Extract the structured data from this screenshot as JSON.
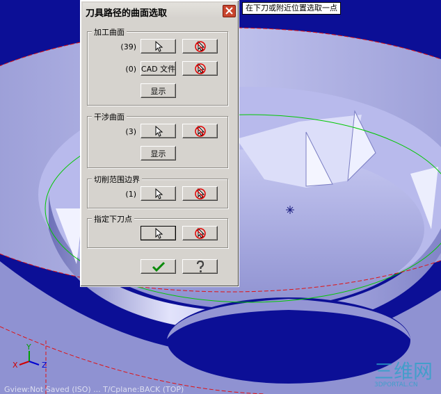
{
  "viewport": {
    "prompt": "在下刀或附近位置选取一点",
    "status_bar": "Gview:Not Saved (ISO)   ...   T/Cplane:BACK (TOP)",
    "axis_labels": {
      "x": "X",
      "y": "Y",
      "z": "Z"
    },
    "colors": {
      "background": "#0c0f96",
      "surface": "#9d9fd8",
      "boundary": "#00c800"
    }
  },
  "watermark": {
    "text": "三维网",
    "subtext": "3DPORTAL.CN"
  },
  "dialog": {
    "title": "刀具路径的曲面选取",
    "close_icon": "close-icon",
    "groups": {
      "machining": {
        "label": "加工曲面",
        "count": "(39)",
        "cad_count": "(0)",
        "cad_label": "CAD 文件",
        "show_label": "显示"
      },
      "check": {
        "label": "干涉曲面",
        "count": "(3)",
        "show_label": "显示"
      },
      "containment": {
        "label": "切削范围边界",
        "count": "(1)"
      },
      "entry": {
        "label": "指定下刀点"
      }
    },
    "icons": {
      "select": "cursor-arrow-icon",
      "deselect": "cursor-cancel-icon",
      "ok": "checkmark-icon",
      "help": "question-mark-icon"
    }
  }
}
